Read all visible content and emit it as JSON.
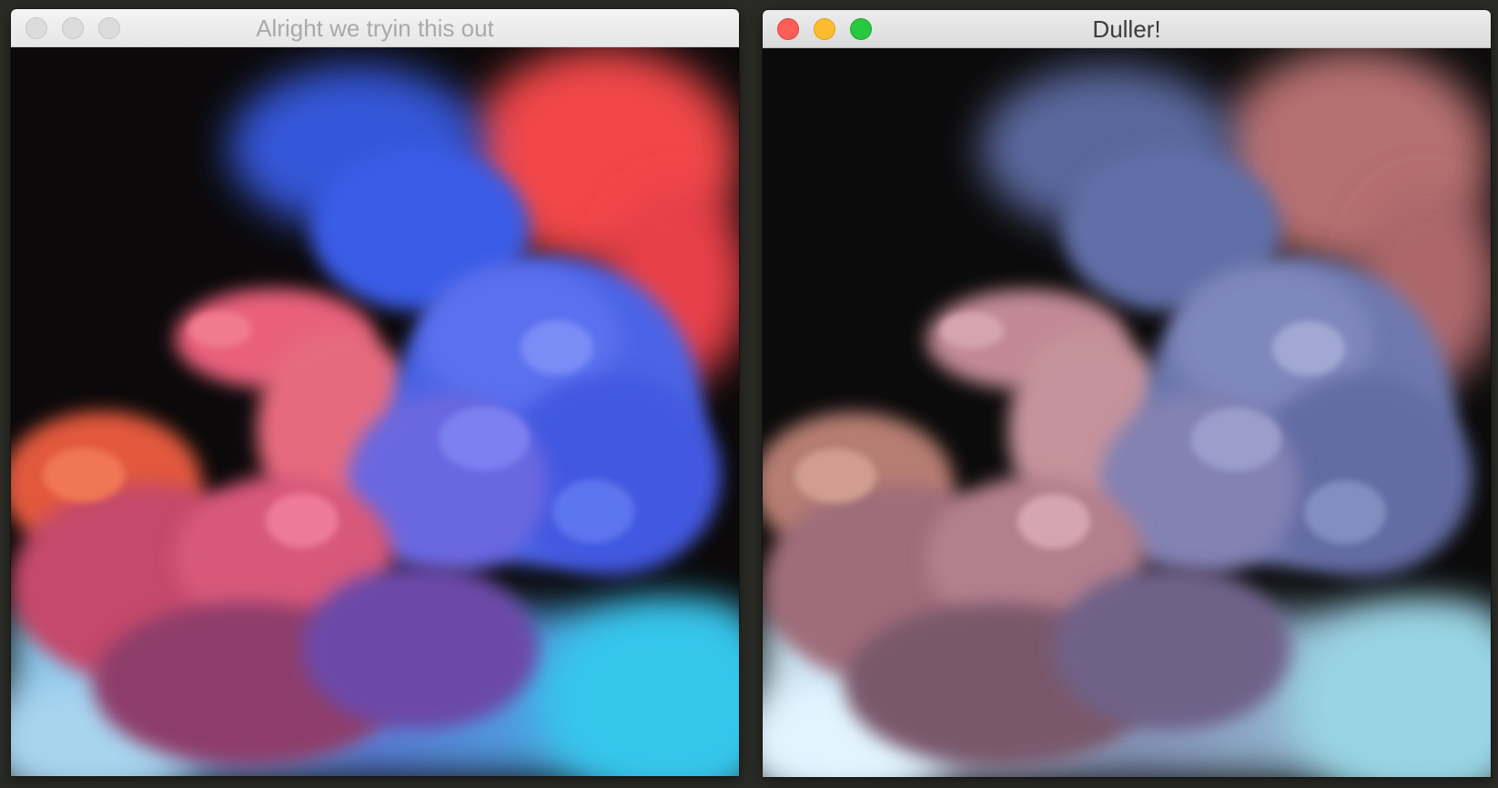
{
  "windows": [
    {
      "title": "Alright we tryin this out",
      "focused": false,
      "image": {
        "description_icon": "ink-smoke-image",
        "saturation": 1.0,
        "brightness": 1.0
      }
    },
    {
      "title": "Duller!",
      "focused": true,
      "image": {
        "description_icon": "ink-smoke-image",
        "saturation": 0.35,
        "brightness": 1.18
      }
    }
  ],
  "colors": {
    "traffic_close": "#fc5f57",
    "traffic_minimize": "#fdbc2e",
    "traffic_zoom": "#28c840",
    "traffic_inactive": "#dcdcdc",
    "desktop_bg": "#2a2a26"
  }
}
